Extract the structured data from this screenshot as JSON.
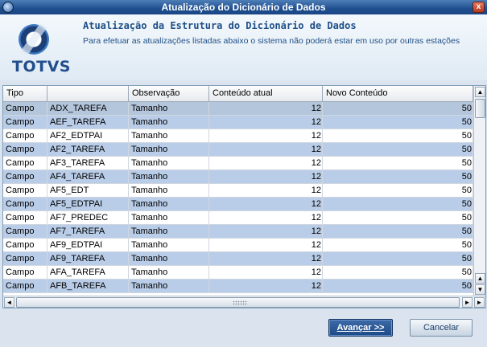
{
  "window": {
    "title": "Atualização do Dicionário de Dados",
    "close_label": "x"
  },
  "header": {
    "logo_text": "TOTVS",
    "title": "Atualização da Estrutura do Dicionário de Dados",
    "subtitle": "Para efetuar as atualizações listadas abaixo o sistema não poderá estar em uso por outras estações"
  },
  "grid": {
    "columns": [
      "Tipo",
      "",
      "Observação",
      "Conteúdo atual",
      "Novo Conteúdo"
    ],
    "rows": [
      [
        "Campo",
        "ADX_TAREFA",
        "Tamanho",
        "12",
        "50"
      ],
      [
        "Campo",
        "AEF_TAREFA",
        "Tamanho",
        "12",
        "50"
      ],
      [
        "Campo",
        "AF2_EDTPAI",
        "Tamanho",
        "12",
        "50"
      ],
      [
        "Campo",
        "AF2_TAREFA",
        "Tamanho",
        "12",
        "50"
      ],
      [
        "Campo",
        "AF3_TAREFA",
        "Tamanho",
        "12",
        "50"
      ],
      [
        "Campo",
        "AF4_TAREFA",
        "Tamanho",
        "12",
        "50"
      ],
      [
        "Campo",
        "AF5_EDT",
        "Tamanho",
        "12",
        "50"
      ],
      [
        "Campo",
        "AF5_EDTPAI",
        "Tamanho",
        "12",
        "50"
      ],
      [
        "Campo",
        "AF7_PREDEC",
        "Tamanho",
        "12",
        "50"
      ],
      [
        "Campo",
        "AF7_TAREFA",
        "Tamanho",
        "12",
        "50"
      ],
      [
        "Campo",
        "AF9_EDTPAI",
        "Tamanho",
        "12",
        "50"
      ],
      [
        "Campo",
        "AF9_TAREFA",
        "Tamanho",
        "12",
        "50"
      ],
      [
        "Campo",
        "AFA_TAREFA",
        "Tamanho",
        "12",
        "50"
      ],
      [
        "Campo",
        "AFB_TAREFA",
        "Tamanho",
        "12",
        "50"
      ]
    ]
  },
  "buttons": {
    "next_label": "Avançar >>",
    "cancel_label": "Cancelar"
  },
  "icons": {
    "scroll_up": "▲",
    "scroll_down": "▼",
    "scroll_left": "◄",
    "scroll_right": "►"
  }
}
